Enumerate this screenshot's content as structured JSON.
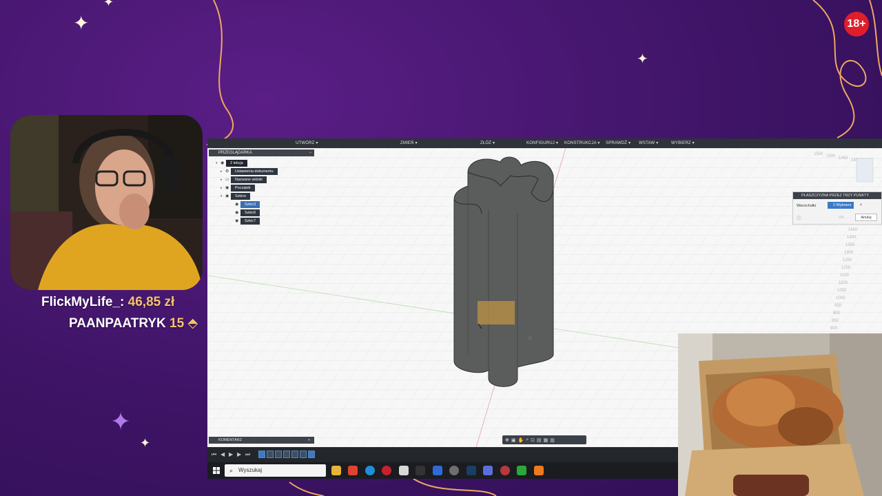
{
  "overlay": {
    "age_rating": "18+",
    "donation": {
      "user": "FlickMyLife_",
      "amount": "46,85 zł"
    },
    "sub": {
      "user": "PAANPAATRYK",
      "months": "15"
    },
    "colors": {
      "background": "#3e1466",
      "accent_gold": "#f4c46a",
      "badge_red": "#e01e2b"
    }
  },
  "fusion": {
    "menu": [
      "UTWÓRZ ▾",
      "ZMIEŃ ▾",
      "ZŁÓŻ ▾",
      "KONFIGURUJ ▾",
      "KONSTRUKCJA ▾",
      "SPRAWDŹ ▾",
      "WSTAW ▾",
      "WYBIERZ ▾"
    ],
    "browser": {
      "title": "PRZEGLĄDARKA",
      "root": "2 lekcja",
      "items": [
        "Ustawienia dokumentu",
        "Nazwane widoki",
        "Początek",
        "Szkice"
      ],
      "sketches": [
        "Szkic3",
        "Szkic6",
        "Szkic7"
      ]
    },
    "plane_dialog": {
      "title": "PŁASZCZYZNA PRZEZ TRZY PUNKTY",
      "label": "Wierzchołki",
      "selection": "2 Wybrane",
      "ok": "OK",
      "cancel": "Anuluj"
    },
    "comment_panel": "KOMENTARZ",
    "ruler_values": [
      "1450",
      "1400",
      "1350",
      "1300",
      "1250",
      "1200",
      "1150",
      "1100",
      "1050",
      "1000",
      "950",
      "900",
      "850",
      "800",
      "750",
      "700",
      "650"
    ],
    "top_ruler_values": [
      "1550",
      "1500",
      "1450",
      "1400",
      "1350"
    ]
  },
  "taskbar": {
    "search_placeholder": "Wyszukaj"
  }
}
